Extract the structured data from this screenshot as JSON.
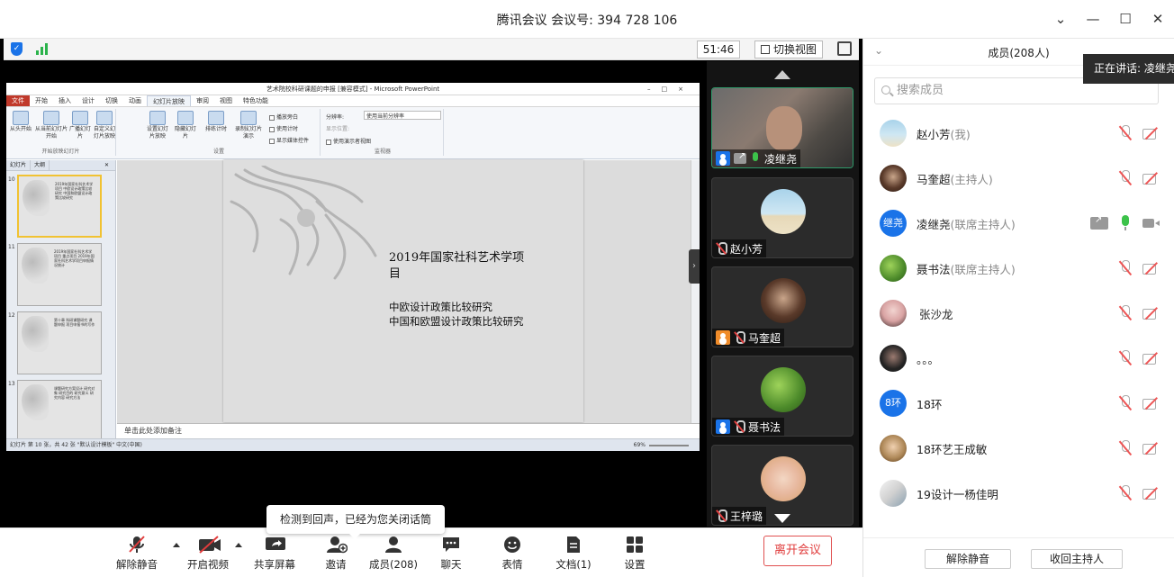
{
  "window": {
    "title": "腾讯会议 会议号: 394 728 106",
    "controls": [
      "⌄",
      "—",
      "☐",
      "✕"
    ]
  },
  "top_bar": {
    "timer": "51:46",
    "switch_view_label": "切换视图"
  },
  "ppt": {
    "title": "艺术院校科研课题的申报 [兼容模式] - Microsoft PowerPoint",
    "tabs": [
      "文件",
      "开始",
      "插入",
      "设计",
      "切换",
      "动画",
      "幻灯片放映",
      "审阅",
      "视图",
      "特色功能"
    ],
    "active_tab": "幻灯片放映",
    "ribbon": {
      "start_group": [
        "从头开始",
        "从当前幻灯片开始",
        "广播幻灯片",
        "自定义幻灯片放映"
      ],
      "start_group_label": "开始放映幻灯片",
      "setup_buttons": [
        "设置幻灯片放映",
        "隐藏幻灯片",
        "排练计时",
        "录制幻灯片演示"
      ],
      "setup_checks": [
        "播放旁白",
        "使用计时",
        "显示媒体控件"
      ],
      "setup_label": "设置",
      "monitor_items": [
        "分辨率:",
        "使用当前分辨率",
        "显示位置:",
        "使用演示者视图"
      ],
      "monitor_label": "监视器"
    },
    "left_tabs": [
      "幻灯片",
      "大纲"
    ],
    "thumbnails": [
      {
        "num": "10",
        "text": "2019年国家社科艺术学项目 中欧设计政策比较研究 中国和欧盟设计政策比较研究"
      },
      {
        "num": "11",
        "text": "2019年国家社科艺术学项目 重点项目 2019年国家社科艺术学项目申报情况统计"
      },
      {
        "num": "12",
        "text": "第十章 科研课题研究 课题申报 项目申报书的写作"
      },
      {
        "num": "13",
        "text": "课题研究方案设计 研究对象 研究目的 研究意义 研究内容 研究方法"
      }
    ],
    "slide_title": "2019年国家社科艺术学项目",
    "slide_body": "中欧设计政策比较研究\n中国和欧盟设计政策比较研究",
    "notes_placeholder": "单击此处添加备注",
    "status": "幻灯片 第 10 张，共 42 张    \"默认设计模板\"    中文(中国)",
    "zoom": "69%"
  },
  "video_tiles": [
    {
      "name": "凌继尧",
      "active": true
    },
    {
      "name": "赵小芳"
    },
    {
      "name": "马奎超"
    },
    {
      "name": "聂书法"
    },
    {
      "name": "王梓璐"
    }
  ],
  "sidebar": {
    "title": "成员(208人)",
    "speaking_tip": "正在讲话: 凌继尧",
    "search_placeholder": "搜索成员",
    "members": [
      {
        "name": "赵小芳",
        "role": "(我)",
        "avatar_text": "",
        "avatar_color": "#9ec6e0",
        "mic": "off",
        "cam": "off"
      },
      {
        "name": "马奎超",
        "role": "(主持人)",
        "avatar_text": "",
        "avatar_color": "#5a3a2a",
        "mic": "off",
        "cam": "off"
      },
      {
        "name": "凌继尧",
        "role": "(联席主持人)",
        "avatar_text": "继尧",
        "avatar_color": "#1a73e8",
        "mic": "on",
        "cam": "on",
        "share": true
      },
      {
        "name": "聂书法",
        "role": "(联席主持人)",
        "avatar_text": "",
        "avatar_color": "#4c8a2a",
        "mic": "off",
        "cam": "off"
      },
      {
        "name": "张沙龙",
        "role": "",
        "avatar_text": "",
        "avatar_color": "#d9a3a3",
        "mic": "off",
        "cam": "off"
      },
      {
        "name": "。。。",
        "role": "",
        "avatar_text": "",
        "avatar_color": "#222222",
        "mic": "off",
        "cam": "off"
      },
      {
        "name": "18环",
        "role": "",
        "avatar_text": "8环",
        "avatar_color": "#1a73e8",
        "mic": "off",
        "cam": "off"
      },
      {
        "name": "18环艺王成敏",
        "role": "",
        "avatar_text": "",
        "avatar_color": "#b08a5a",
        "mic": "off",
        "cam": "off"
      },
      {
        "name": "19设计一杨佳明",
        "role": "",
        "avatar_text": "",
        "avatar_color": "#d0d0d0",
        "mic": "off",
        "cam": "off"
      }
    ],
    "unmute_all": "解除静音",
    "reclaim_host": "收回主持人"
  },
  "toolbar": {
    "items": [
      {
        "label": "解除静音",
        "icon": "mic-off-icon"
      },
      {
        "label": "开启视频",
        "icon": "camera-off-icon"
      },
      {
        "label": "共享屏幕",
        "icon": "share-screen-icon"
      },
      {
        "label": "邀请",
        "icon": "invite-icon"
      },
      {
        "label": "成员(208)",
        "icon": "members-icon"
      },
      {
        "label": "聊天",
        "icon": "chat-icon"
      },
      {
        "label": "表情",
        "icon": "emoji-icon"
      },
      {
        "label": "文档(1)",
        "icon": "document-icon"
      },
      {
        "label": "设置",
        "icon": "settings-icon"
      }
    ],
    "leave_label": "离开会议",
    "echo_tip": "检测到回声，已经为您关闭话筒"
  },
  "colors": {
    "accent_blue": "#1a73e8",
    "leave_red": "#e03b3b",
    "mic_green": "#3cc24a",
    "muted_red": "#e05050"
  }
}
